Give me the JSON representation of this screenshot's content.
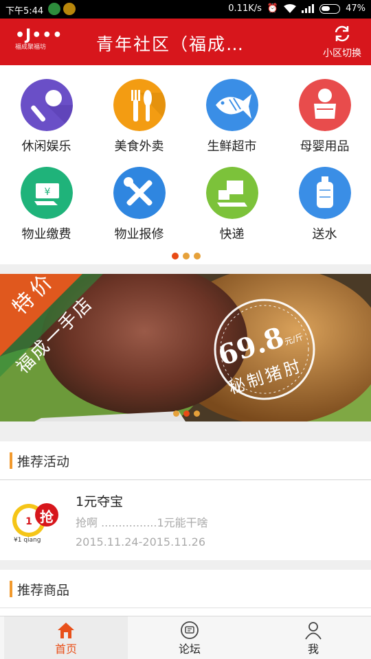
{
  "status_bar": {
    "time": "下午5:44",
    "network_speed": "0.11K/s",
    "battery": "47%"
  },
  "header": {
    "logo_text": "福成聚福坊",
    "title": "青年社区（福成…",
    "switch_label": "小区切换",
    "brand_color": "#d7161c"
  },
  "services": [
    {
      "label": "休闲娱乐",
      "icon": "microphone-icon",
      "color": "#6a4fc7"
    },
    {
      "label": "美食外卖",
      "icon": "fork-knife-icon",
      "color": "#f39c12"
    },
    {
      "label": "生鲜超市",
      "icon": "fish-icon",
      "color": "#3a8ee6"
    },
    {
      "label": "母婴用品",
      "icon": "baby-icon",
      "color": "#e84c4c"
    },
    {
      "label": "物业缴费",
      "icon": "money-hand-icon",
      "color": "#1fb37a"
    },
    {
      "label": "物业报修",
      "icon": "tools-icon",
      "color": "#2f86e0"
    },
    {
      "label": "快递",
      "icon": "package-hand-icon",
      "color": "#7cc23a"
    },
    {
      "label": "送水",
      "icon": "water-bottle-icon",
      "color": "#3a8ee6"
    }
  ],
  "banner": {
    "tag_special": "特价",
    "tag_store": "福成一手店",
    "price": "69.8",
    "price_unit": "元/斤",
    "product": "秘制猪肘"
  },
  "recommend_activity": {
    "heading": "推荐活动",
    "item": {
      "title": "1元夺宝",
      "description": "抢啊 ................1元能干啥",
      "date_range": "2015.11.24-2015.11.26",
      "badge_grab": "抢",
      "badge_price": "¥1 qiang"
    }
  },
  "recommend_goods": {
    "heading": "推荐商品"
  },
  "tabs": [
    {
      "label": "首页",
      "icon": "home-icon",
      "active": true
    },
    {
      "label": "论坛",
      "icon": "chat-icon",
      "active": false
    },
    {
      "label": "我",
      "icon": "user-icon",
      "active": false
    }
  ],
  "accent_color": "#e8501a"
}
